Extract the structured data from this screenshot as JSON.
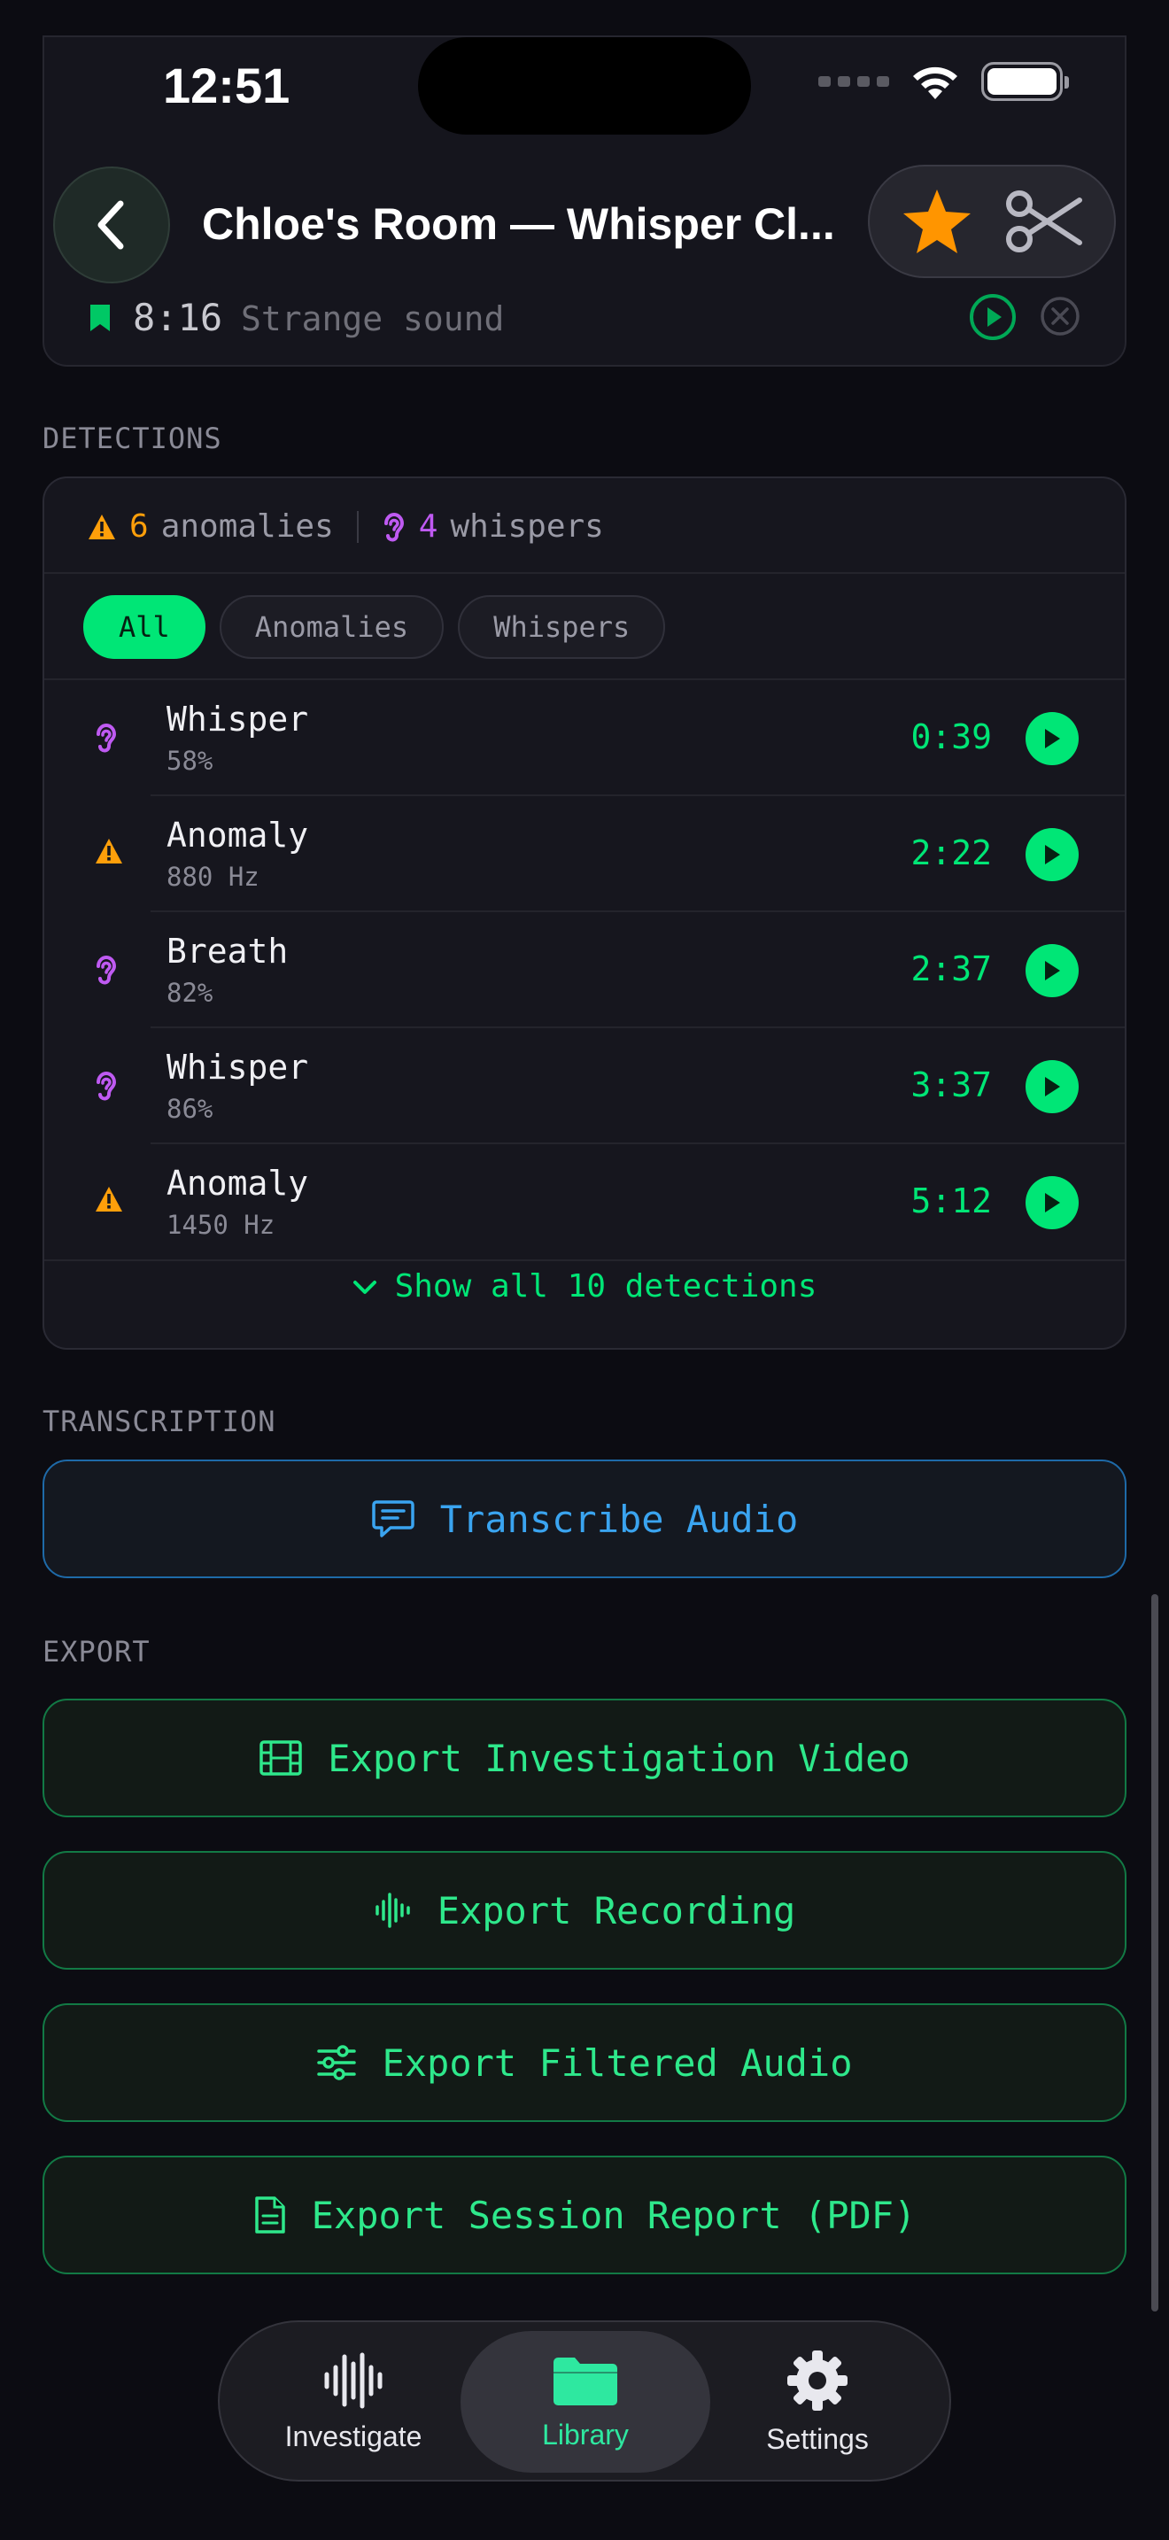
{
  "status": {
    "time": "12:51"
  },
  "nav": {
    "title": "Chloe's Room — Whisper Cl..."
  },
  "bookmark": {
    "time": "8:16",
    "label": "Strange sound"
  },
  "sections": {
    "detections": "DETECTIONS",
    "transcription": "TRANSCRIPTION",
    "export": "EXPORT"
  },
  "summary": {
    "anomaly_count": "6",
    "anomaly_label": "anomalies",
    "whisper_count": "4",
    "whisper_label": "whispers"
  },
  "filters": [
    {
      "label": "All",
      "active": true
    },
    {
      "label": "Anomalies",
      "active": false
    },
    {
      "label": "Whispers",
      "active": false
    }
  ],
  "detections": [
    {
      "type": "whisper",
      "title": "Whisper",
      "sub": "58%",
      "time": "0:39"
    },
    {
      "type": "anomaly",
      "title": "Anomaly",
      "sub": "880 Hz",
      "time": "2:22"
    },
    {
      "type": "whisper",
      "title": "Breath",
      "sub": "82%",
      "time": "2:37"
    },
    {
      "type": "whisper",
      "title": "Whisper",
      "sub": "86%",
      "time": "3:37"
    },
    {
      "type": "anomaly",
      "title": "Anomaly",
      "sub": "1450 Hz",
      "time": "5:12"
    }
  ],
  "show_all": "Show all 10 detections",
  "transcribe": "Transcribe Audio",
  "export": {
    "video": "Export Investigation Video",
    "recording": "Export Recording",
    "filtered": "Export Filtered Audio",
    "report": "Export Session Report (PDF)"
  },
  "tabs": [
    {
      "label": "Investigate"
    },
    {
      "label": "Library"
    },
    {
      "label": "Settings"
    }
  ],
  "colors": {
    "accent": "#00e676",
    "anomaly": "#ff9f0a",
    "whisper": "#bf5af2",
    "transcribe": "#3aa4f0",
    "background": "#0c0c12"
  }
}
